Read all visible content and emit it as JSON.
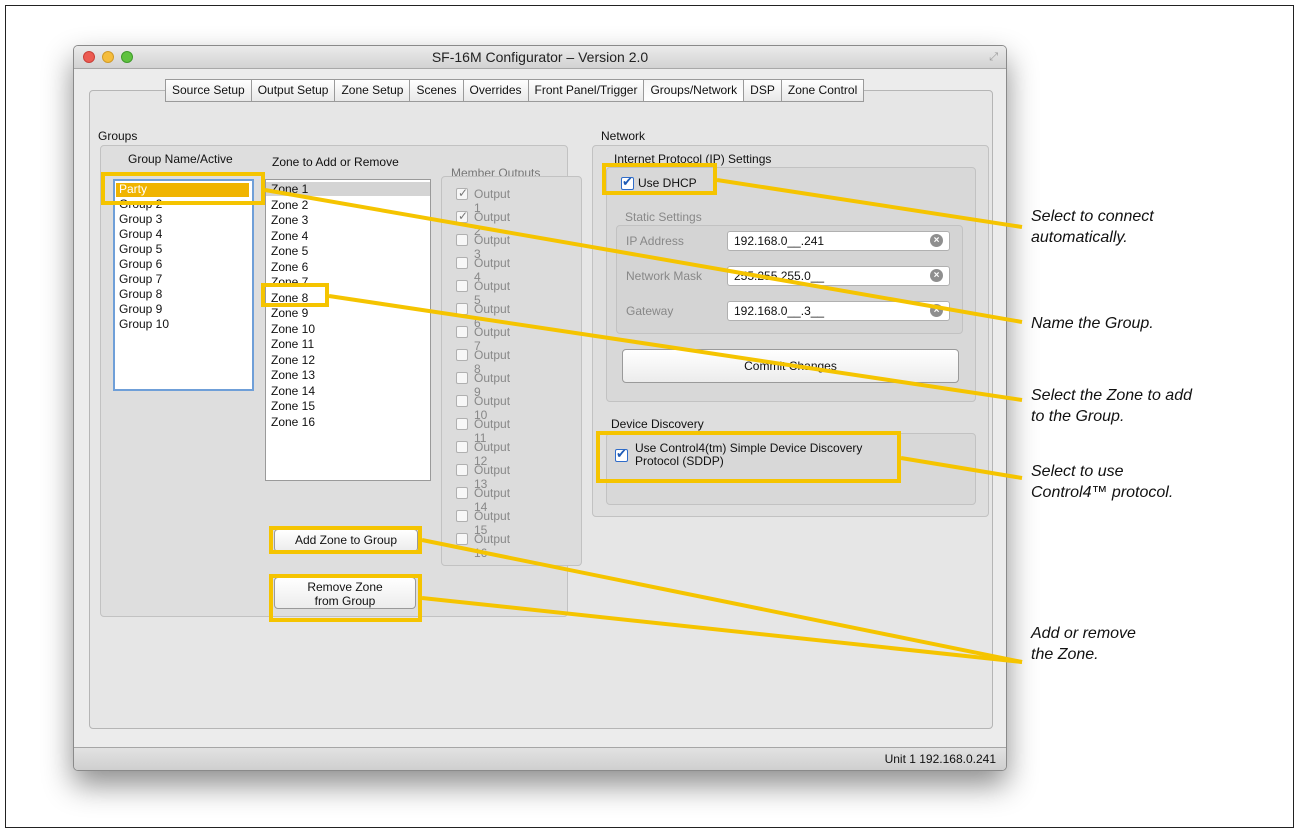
{
  "window": {
    "title": "SF-16M Configurator – Version 2.0",
    "tabs": [
      "Source Setup",
      "Output Setup",
      "Zone Setup",
      "Scenes",
      "Overrides",
      "Front Panel/Trigger",
      "Groups/Network",
      "DSP",
      "Zone Control"
    ],
    "active_tab": "Groups/Network"
  },
  "groups": {
    "section_title": "Groups",
    "name_header": "Group Name/Active",
    "zone_header": "Zone to Add or Remove",
    "member_header": "Member Outputs",
    "group_names": [
      "Party",
      "Group 2",
      "Group 3",
      "Group 4",
      "Group 5",
      "Group 6",
      "Group 7",
      "Group 8",
      "Group 9",
      "Group 10"
    ],
    "zones": [
      "Zone 1",
      "Zone 2",
      "Zone 3",
      "Zone 4",
      "Zone 5",
      "Zone 6",
      "Zone 7",
      "Zone 8",
      "Zone 9",
      "Zone 10",
      "Zone 11",
      "Zone 12",
      "Zone 13",
      "Zone 14",
      "Zone 15",
      "Zone 16"
    ],
    "outputs": [
      {
        "label": "Output 1",
        "checked": true
      },
      {
        "label": "Output 2",
        "checked": true
      },
      {
        "label": "Output 3",
        "checked": false
      },
      {
        "label": "Output 4",
        "checked": false
      },
      {
        "label": "Output 5",
        "checked": false
      },
      {
        "label": "Output 6",
        "checked": false
      },
      {
        "label": "Output 7",
        "checked": false
      },
      {
        "label": "Output 8",
        "checked": false
      },
      {
        "label": "Output 9",
        "checked": false
      },
      {
        "label": "Output 10",
        "checked": false
      },
      {
        "label": "Output 11",
        "checked": false
      },
      {
        "label": "Output 12",
        "checked": false
      },
      {
        "label": "Output 13",
        "checked": false
      },
      {
        "label": "Output 14",
        "checked": false
      },
      {
        "label": "Output 15",
        "checked": false
      },
      {
        "label": "Output 16",
        "checked": false
      }
    ],
    "add_button": "Add Zone to Group",
    "remove_button_line1": "Remove Zone",
    "remove_button_line2": "from Group"
  },
  "network": {
    "section_title": "Network",
    "ip_title": "Internet Protocol (IP) Settings",
    "dhcp_label": "Use DHCP",
    "static_title": "Static Settings",
    "ip_label": "IP Address",
    "ip_value": "192.168.0__.241",
    "mask_label": "Network Mask",
    "mask_value": "255.255.255.0__",
    "gateway_label": "Gateway",
    "gateway_value": "192.168.0__.3__",
    "commit_button": "Commit Changes",
    "discovery_title": "Device Discovery",
    "sddp_line1": "Use Control4(tm) Simple Device Discovery",
    "sddp_line2": "Protocol (SDDP)"
  },
  "status": "Unit 1  192.168.0.241",
  "annotations": {
    "a1_line1": "Select to connect",
    "a1_line2": "automatically.",
    "a2": "Name the Group.",
    "a3_line1": "Select the Zone to add",
    "a3_line2": "to the Group.",
    "a4_line1": "Select to use",
    "a4_line2": "Control4™ protocol.",
    "a5_line1": "Add or remove",
    "a5_line2": "the Zone."
  },
  "colors": {
    "highlight": "#f5c400",
    "selection": "#f0b400"
  }
}
